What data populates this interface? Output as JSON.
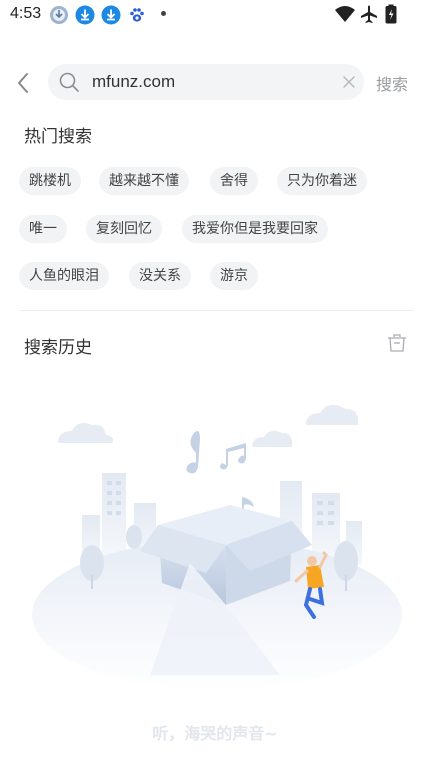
{
  "status_bar": {
    "time": "4:53",
    "icons": [
      "download-complete-icon",
      "download-icon",
      "download-icon",
      "baidu-paw-icon",
      "dot-icon",
      "wifi-icon",
      "airplane-icon",
      "battery-icon"
    ]
  },
  "search": {
    "value": "mfunz.com",
    "submit_label": "搜索"
  },
  "hot_search": {
    "title": "热门搜索",
    "tags": [
      "跳楼机",
      "越来越不懂",
      "舍得",
      "只为你着迷",
      "唯一",
      "复刻回忆",
      "我爱你但是我要回家",
      "人鱼的眼泪",
      "没关系",
      "游京"
    ]
  },
  "history": {
    "title": "搜索历史",
    "empty_text": "听，海哭的声音~"
  },
  "colors": {
    "tag_bg": "#f2f3f5",
    "search_bg": "#f3f4f6",
    "muted_text": "#9a9ca0",
    "illustration_blue": "#c9d6ea",
    "figure_accent": "#f6a623"
  }
}
